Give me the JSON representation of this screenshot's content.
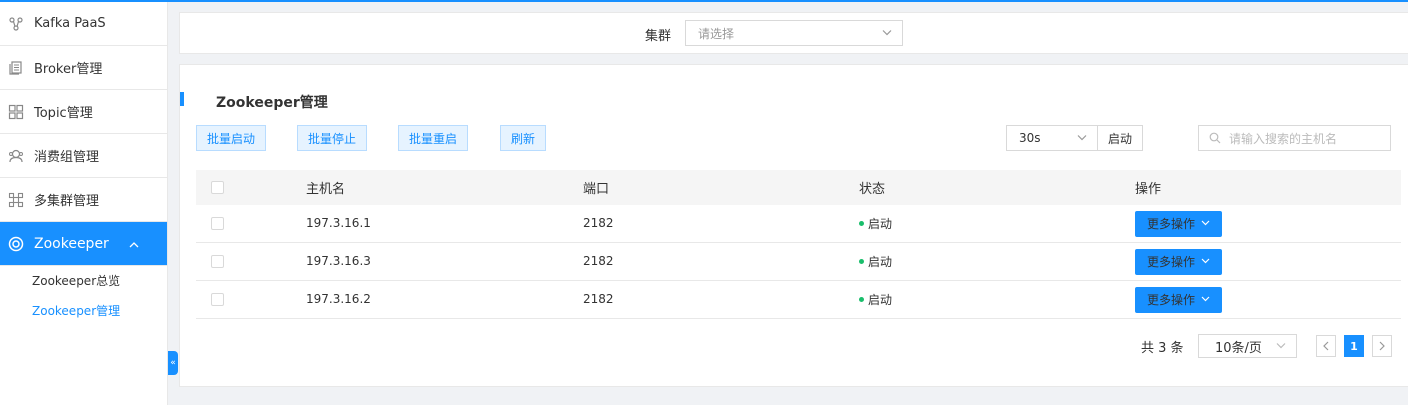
{
  "sidebar": {
    "items": [
      {
        "label": "Kafka PaaS",
        "icon": "cluster-nodes-icon"
      },
      {
        "label": "Broker管理",
        "icon": "document-stack-icon"
      },
      {
        "label": "Topic管理",
        "icon": "grid-icon"
      },
      {
        "label": "消费组管理",
        "icon": "users-icon"
      },
      {
        "label": "多集群管理",
        "icon": "multi-cluster-icon"
      },
      {
        "label": "Zookeeper",
        "icon": "lifebuoy-icon",
        "expanded": true
      }
    ],
    "subitems": [
      {
        "label": "Zookeeper总览",
        "active": false
      },
      {
        "label": "Zookeeper管理",
        "active": true
      }
    ],
    "collapse_glyph": "«"
  },
  "filter": {
    "label": "集群",
    "placeholder": "请选择"
  },
  "card": {
    "title": "Zookeeper管理",
    "buttons": {
      "batch_start": "批量启动",
      "batch_stop": "批量停止",
      "batch_restart": "批量重启",
      "refresh": "刷新"
    },
    "interval": {
      "value": "30s",
      "action": "启动"
    },
    "search_placeholder": "请输入搜索的主机名"
  },
  "table": {
    "columns": [
      "主机名",
      "端口",
      "状态",
      "操作"
    ],
    "rows": [
      {
        "host": "197.3.16.1",
        "port": "2182",
        "status": "启动",
        "action": "更多操作"
      },
      {
        "host": "197.3.16.3",
        "port": "2182",
        "status": "启动",
        "action": "更多操作"
      },
      {
        "host": "197.3.16.2",
        "port": "2182",
        "status": "启动",
        "action": "更多操作"
      }
    ]
  },
  "pagination": {
    "total": "共 3 条",
    "page_size": "10条/页",
    "current_page": "1"
  },
  "colors": {
    "primary": "#1890ff",
    "status_running": "#19be6b"
  }
}
